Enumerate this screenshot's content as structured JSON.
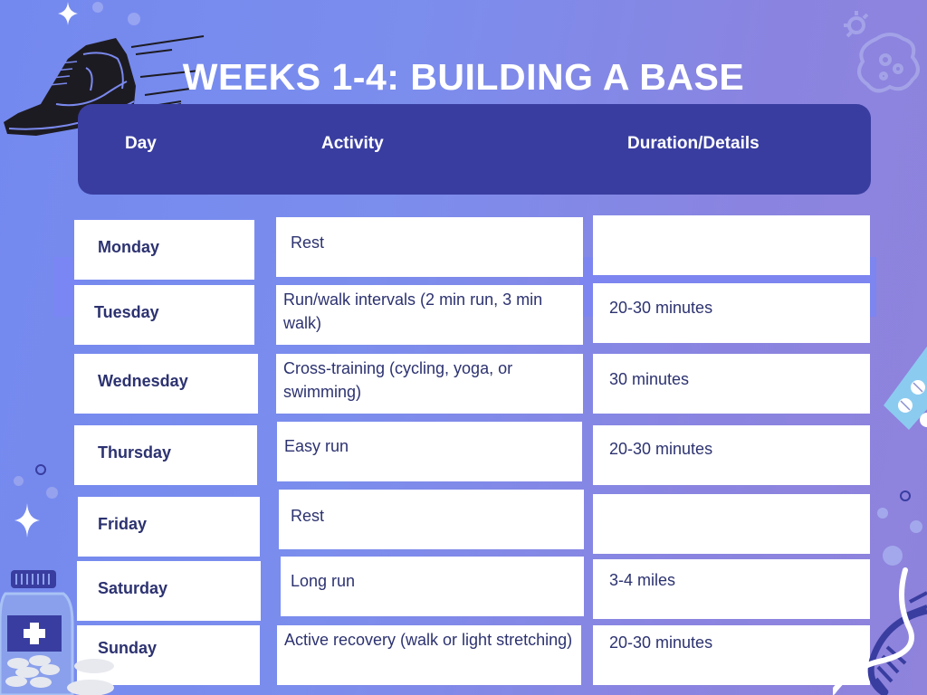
{
  "title": "WEEKS 1-4: BUILDING A BASE",
  "table": {
    "headers": {
      "day": "Day",
      "activity": "Activity",
      "duration": "Duration/Details"
    },
    "rows": [
      {
        "day": "Monday",
        "activity": "Rest",
        "duration": ""
      },
      {
        "day": "Tuesday",
        "activity": "Run/walk intervals (2 min run, 3 min walk)",
        "duration": "20-30 minutes"
      },
      {
        "day": "Wednesday",
        "activity": "Cross-training (cycling, yoga, or swimming)",
        "duration": "30 minutes"
      },
      {
        "day": "Thursday",
        "activity": "Easy run",
        "duration": "20-30 minutes"
      },
      {
        "day": "Friday",
        "activity": "Rest",
        "duration": ""
      },
      {
        "day": "Saturday",
        "activity": "Long run",
        "duration": "3-4 miles"
      },
      {
        "day": "Sunday",
        "activity": "Active recovery (walk or light stretching)",
        "duration": "20-30 minutes"
      }
    ]
  },
  "decorations": {
    "icons": [
      "running-shoe-icon",
      "sparkle-icon",
      "virus-icon",
      "pill-bottle-icon",
      "pill-blister-icon",
      "dna-icon"
    ]
  },
  "colors": {
    "header_bg": "#393da0",
    "text_dark": "#2c3270",
    "background_start": "#7489ef",
    "background_end": "#8f83dc"
  }
}
